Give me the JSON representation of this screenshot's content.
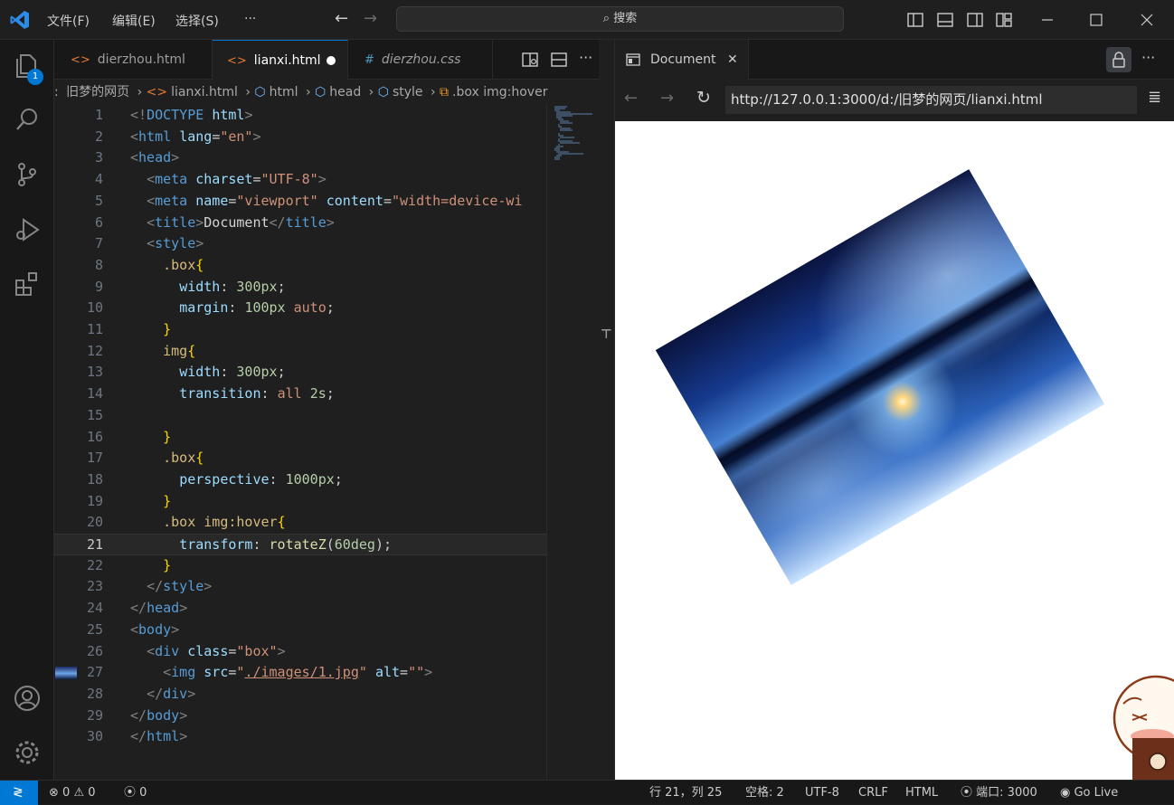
{
  "titlebar": {
    "menus": [
      "文件(F)",
      "编辑(E)",
      "选择(S)",
      "···"
    ],
    "search_placeholder": "搜索"
  },
  "activity": {
    "explorer_badge": "1"
  },
  "editor_tabs": [
    {
      "label": "dierzhou.html",
      "icon": "html-icon",
      "active": false
    },
    {
      "label": "lianxi.html",
      "icon": "html-icon",
      "active": true,
      "modified": true
    },
    {
      "label": "dierzhou.css",
      "icon": "css-icon",
      "active": false
    }
  ],
  "breadcrumb": [
    ":",
    "旧梦的网页",
    "lianxi.html",
    "html",
    "head",
    "style",
    ".box img:hover"
  ],
  "code_lines": [
    {
      "n": "1",
      "html": "<span class='t-br'>&lt;!</span><span class='t-tag'>DOCTYPE</span> <span class='t-attr'>html</span><span class='t-br'>&gt;</span>"
    },
    {
      "n": "2",
      "html": "<span class='t-br'>&lt;</span><span class='t-tag'>html</span> <span class='t-attr'>lang</span>=<span class='t-str'>\"en\"</span><span class='t-br'>&gt;</span>"
    },
    {
      "n": "3",
      "html": "<span class='t-br'>&lt;</span><span class='t-tag'>head</span><span class='t-br'>&gt;</span>"
    },
    {
      "n": "4",
      "html": "  <span class='t-br'>&lt;</span><span class='t-tag'>meta</span> <span class='t-attr'>charset</span>=<span class='t-str'>\"UTF-8\"</span><span class='t-br'>&gt;</span>"
    },
    {
      "n": "5",
      "html": "  <span class='t-br'>&lt;</span><span class='t-tag'>meta</span> <span class='t-attr'>name</span>=<span class='t-str'>\"viewport\"</span> <span class='t-attr'>content</span>=<span class='t-str'>\"width=device-wi</span>"
    },
    {
      "n": "6",
      "html": "  <span class='t-br'>&lt;</span><span class='t-tag'>title</span><span class='t-br'>&gt;</span><span class='t-txt'>Document</span><span class='t-br'>&lt;/</span><span class='t-tag'>title</span><span class='t-br'>&gt;</span>"
    },
    {
      "n": "7",
      "html": "  <span class='t-br'>&lt;</span><span class='t-tag'>style</span><span class='t-br'>&gt;</span>"
    },
    {
      "n": "8",
      "html": "    <span class='t-sel'>.box</span><span class='t-brace'>{</span>"
    },
    {
      "n": "9",
      "html": "      <span class='t-prop'>width</span>: <span class='t-num'>300px</span>;"
    },
    {
      "n": "10",
      "html": "      <span class='t-prop'>margin</span>: <span class='t-num'>100px</span> <span class='t-kw'>auto</span>;"
    },
    {
      "n": "11",
      "html": "    <span class='t-brace'>}</span>"
    },
    {
      "n": "12",
      "html": "    <span class='t-sel'>img</span><span class='t-brace'>{</span>"
    },
    {
      "n": "13",
      "html": "      <span class='t-prop'>width</span>: <span class='t-num'>300px</span>;"
    },
    {
      "n": "14",
      "html": "      <span class='t-prop'>transition</span>: <span class='t-kw'>all</span> <span class='t-num'>2s</span>;"
    },
    {
      "n": "15",
      "html": ""
    },
    {
      "n": "16",
      "html": "    <span class='t-brace'>}</span>"
    },
    {
      "n": "17",
      "html": "    <span class='t-sel'>.box</span><span class='t-brace'>{</span>"
    },
    {
      "n": "18",
      "html": "      <span class='t-prop'>perspective</span>: <span class='t-num'>1000px</span>;"
    },
    {
      "n": "19",
      "html": "    <span class='t-brace'>}</span>"
    },
    {
      "n": "20",
      "html": "    <span class='t-sel'>.box img:hover</span><span class='t-brace'>{</span>"
    },
    {
      "n": "21",
      "html": "      <span class='t-prop'>transform</span>: <span class='t-fn'>rotateZ</span>(<span class='t-num'>60deg</span>);",
      "current": true
    },
    {
      "n": "22",
      "html": "    <span class='t-brace'>}</span>"
    },
    {
      "n": "23",
      "html": "  <span class='t-br'>&lt;/</span><span class='t-tag'>style</span><span class='t-br'>&gt;</span>"
    },
    {
      "n": "24",
      "html": "<span class='t-br'>&lt;/</span><span class='t-tag'>head</span><span class='t-br'>&gt;</span>"
    },
    {
      "n": "25",
      "html": "<span class='t-br'>&lt;</span><span class='t-tag'>body</span><span class='t-br'>&gt;</span>"
    },
    {
      "n": "26",
      "html": "  <span class='t-br'>&lt;</span><span class='t-tag'>div</span> <span class='t-attr'>class</span>=<span class='t-str'>\"box\"</span><span class='t-br'>&gt;</span>"
    },
    {
      "n": "27",
      "html": "    <span class='t-br'>&lt;</span><span class='t-tag'>img</span> <span class='t-attr'>src</span>=<span class='t-str'>\"<u>./images/1.jpg</u>\"</span> <span class='t-attr'>alt</span>=<span class='t-str'>\"\"</span><span class='t-br'>&gt;</span>"
    },
    {
      "n": "28",
      "html": "  <span class='t-br'>&lt;/</span><span class='t-tag'>div</span><span class='t-br'>&gt;</span>"
    },
    {
      "n": "29",
      "html": "<span class='t-br'>&lt;/</span><span class='t-tag'>body</span><span class='t-br'>&gt;</span>"
    },
    {
      "n": "30",
      "html": "<span class='t-br'>&lt;/</span><span class='t-tag'>html</span><span class='t-br'>&gt;</span>"
    }
  ],
  "browser": {
    "tab_title": "Document",
    "url": "http://127.0.0.1:3000/d:/旧梦的网页/lianxi.html",
    "image_rotation_deg": 60
  },
  "statusbar": {
    "errors": "0",
    "warnings": "0",
    "ports": "0",
    "position": "行 21，列 25",
    "spaces": "空格: 2",
    "encoding": "UTF-8",
    "eol": "CRLF",
    "language": "HTML",
    "port": "端口: 3000",
    "golive": "Go Live"
  },
  "colors": {
    "accent": "#0078d4",
    "bg": "#1f1f1f"
  }
}
